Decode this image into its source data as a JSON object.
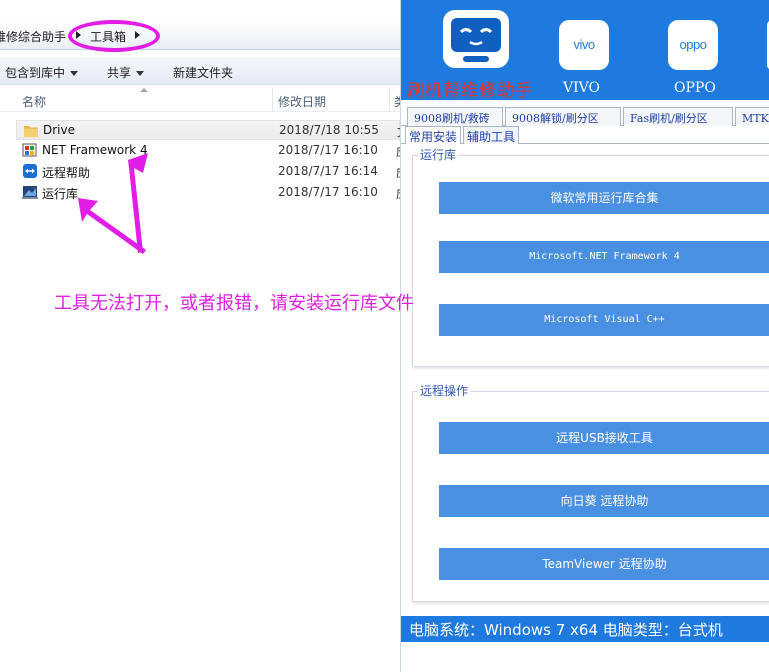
{
  "explorer": {
    "breadcrumb": [
      "维修综合助手",
      "工具箱"
    ],
    "toolbar": [
      "包含到库中",
      "共享",
      "新建文件夹"
    ],
    "columns": {
      "name": "名称",
      "modified": "修改日期",
      "type_cut": "类"
    },
    "files": [
      {
        "name": "Drive",
        "date": "2018/7/18 10:55",
        "type_cut": "文",
        "icon": "folder-icon"
      },
      {
        "name": "NET Framework 4",
        "date": "2018/7/17 16:10",
        "type_cut": "应",
        "icon": "net-framework-icon"
      },
      {
        "name": "远程帮助",
        "date": "2018/7/17 16:14",
        "type_cut": "应",
        "icon": "teamviewer-icon"
      },
      {
        "name": "运行库",
        "date": "2018/7/17 16:10",
        "type_cut": "应",
        "icon": "installer-icon"
      }
    ],
    "annotation": "工具无法打开，或者报错，请安装运行库文件",
    "annotation_color": "#e01fe4"
  },
  "app": {
    "title": "刷机帮维修助手",
    "brands": [
      {
        "logo": "vivo",
        "label": "VIVO"
      },
      {
        "logo": "oppo",
        "label": "OPPO"
      }
    ],
    "tabs_row1": [
      "9008刷机/救砖",
      "9008解锁/刷分区",
      "Fas刷机/刷分区",
      "MTK刷"
    ],
    "tabs_row2": [
      "常用安装",
      "辅助工具"
    ],
    "group_runtime": {
      "title": "运行库",
      "buttons": [
        "微软常用运行库合集",
        "Microsoft.NET Framework 4",
        "Microsoft Visual C++"
      ]
    },
    "group_remote": {
      "title": "远程操作",
      "buttons": [
        "远程USB接收工具",
        "向日葵 远程协助",
        "TeamViewer 远程协助"
      ]
    },
    "status": "电脑系统：Windows 7 x64 电脑类型：台式机",
    "colors": {
      "header": "#1f7ae0",
      "button": "#4a90e2",
      "title": "#e63227"
    }
  }
}
